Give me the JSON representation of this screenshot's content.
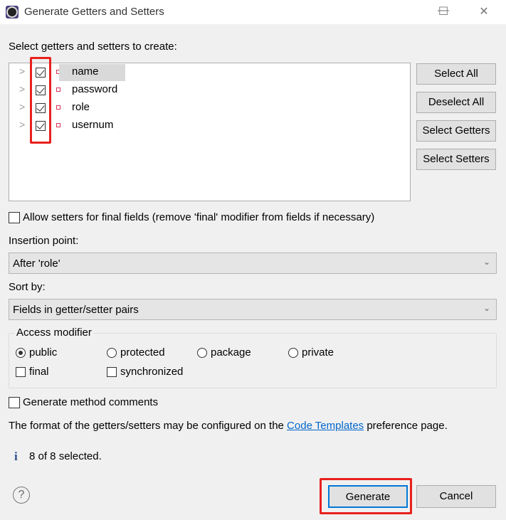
{
  "window": {
    "title": "Generate Getters and Setters",
    "minimize": "—",
    "maximize": "☐",
    "close": "✕"
  },
  "tree": {
    "label": "Select getters and setters to create:",
    "items": [
      {
        "name": "name",
        "checked": true,
        "highlighted": true
      },
      {
        "name": "password",
        "checked": true
      },
      {
        "name": "role",
        "checked": true
      },
      {
        "name": "usernum",
        "checked": true
      }
    ]
  },
  "side_buttons": {
    "select_all": "Select All",
    "deselect_all": "Deselect All",
    "select_getters": "Select Getters",
    "select_setters": "Select Setters"
  },
  "allow_final": {
    "label": "Allow setters for final fields (remove 'final' modifier from fields if necessary)",
    "checked": false
  },
  "insertion_point": {
    "label": "Insertion point:",
    "value": "After 'role'"
  },
  "sort_by": {
    "label": "Sort by:",
    "value": "Fields in getter/setter pairs"
  },
  "access_modifier": {
    "title": "Access modifier",
    "options": [
      "public",
      "protected",
      "package",
      "private"
    ],
    "selected": "public",
    "final_label": "final",
    "synchronized_label": "synchronized"
  },
  "comments": {
    "label": "Generate method comments",
    "checked": false
  },
  "info": {
    "prefix": "The format of the getters/setters may be configured on the ",
    "link": "Code Templates",
    "suffix": " preference page."
  },
  "status": {
    "icon": "i",
    "text": "8 of 8 selected."
  },
  "footer": {
    "help": "?",
    "generate": "Generate",
    "cancel": "Cancel"
  },
  "colors": {
    "highlight_box": "#e8201d",
    "link": "#0066cc",
    "field_icon": "#d9325a"
  }
}
